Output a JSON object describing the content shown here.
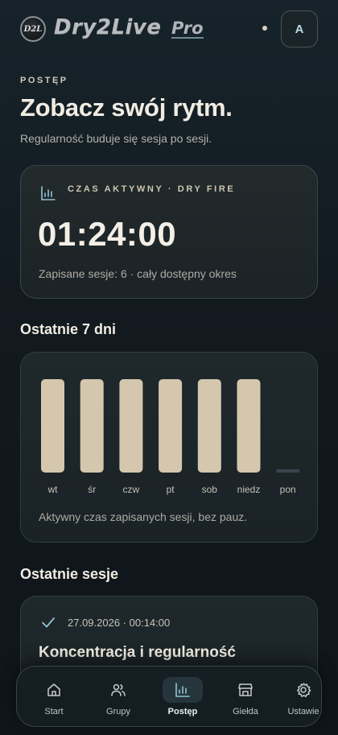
{
  "header": {
    "logo_badge": "D2L",
    "logo_text": "Dry2Live",
    "logo_pro": "Pro",
    "avatar_initial": "A"
  },
  "intro": {
    "eyebrow": "POSTĘP",
    "title": "Zobacz swój rytm.",
    "subtitle": "Regularność buduje się sesja po sesji."
  },
  "stat_card": {
    "icon": "bar-chart-icon",
    "label": "CZAS AKTYWNY · DRY FIRE",
    "value": "01:24:00",
    "note": "Zapisane sesje: 6 · cały dostępny okres"
  },
  "week_section": {
    "title": "Ostatnie 7 dni",
    "note": "Aktywny czas zapisanych sesji, bez pauz."
  },
  "chart_data": {
    "type": "bar",
    "categories": [
      "wt",
      "śr",
      "czw",
      "pt",
      "sob",
      "niedz",
      "pon"
    ],
    "values": [
      1,
      1,
      1,
      1,
      1,
      1,
      0
    ],
    "ylim": [
      0,
      1
    ],
    "grid": false,
    "colors": {
      "bar": "#d4c7ae",
      "empty": "#37464c"
    }
  },
  "sessions_section": {
    "title": "Ostatnie sesje",
    "items": [
      {
        "icon": "check-icon",
        "meta": "27.09.2026 · 00:14:00",
        "title": "Koncentracja i regularność"
      }
    ]
  },
  "nav": {
    "items": [
      {
        "label": "Start",
        "icon": "home-icon",
        "active": false
      },
      {
        "label": "Grupy",
        "icon": "users-icon",
        "active": false
      },
      {
        "label": "Postęp",
        "icon": "bar-chart-icon",
        "active": true
      },
      {
        "label": "Giełda",
        "icon": "store-icon",
        "active": false
      },
      {
        "label": "Ustawie",
        "icon": "gear-icon",
        "active": false
      }
    ]
  },
  "colors": {
    "accent": "#d4c7ae",
    "background": "#131b20",
    "card": "#1f292c",
    "icon_teal": "#8fc3d6"
  }
}
